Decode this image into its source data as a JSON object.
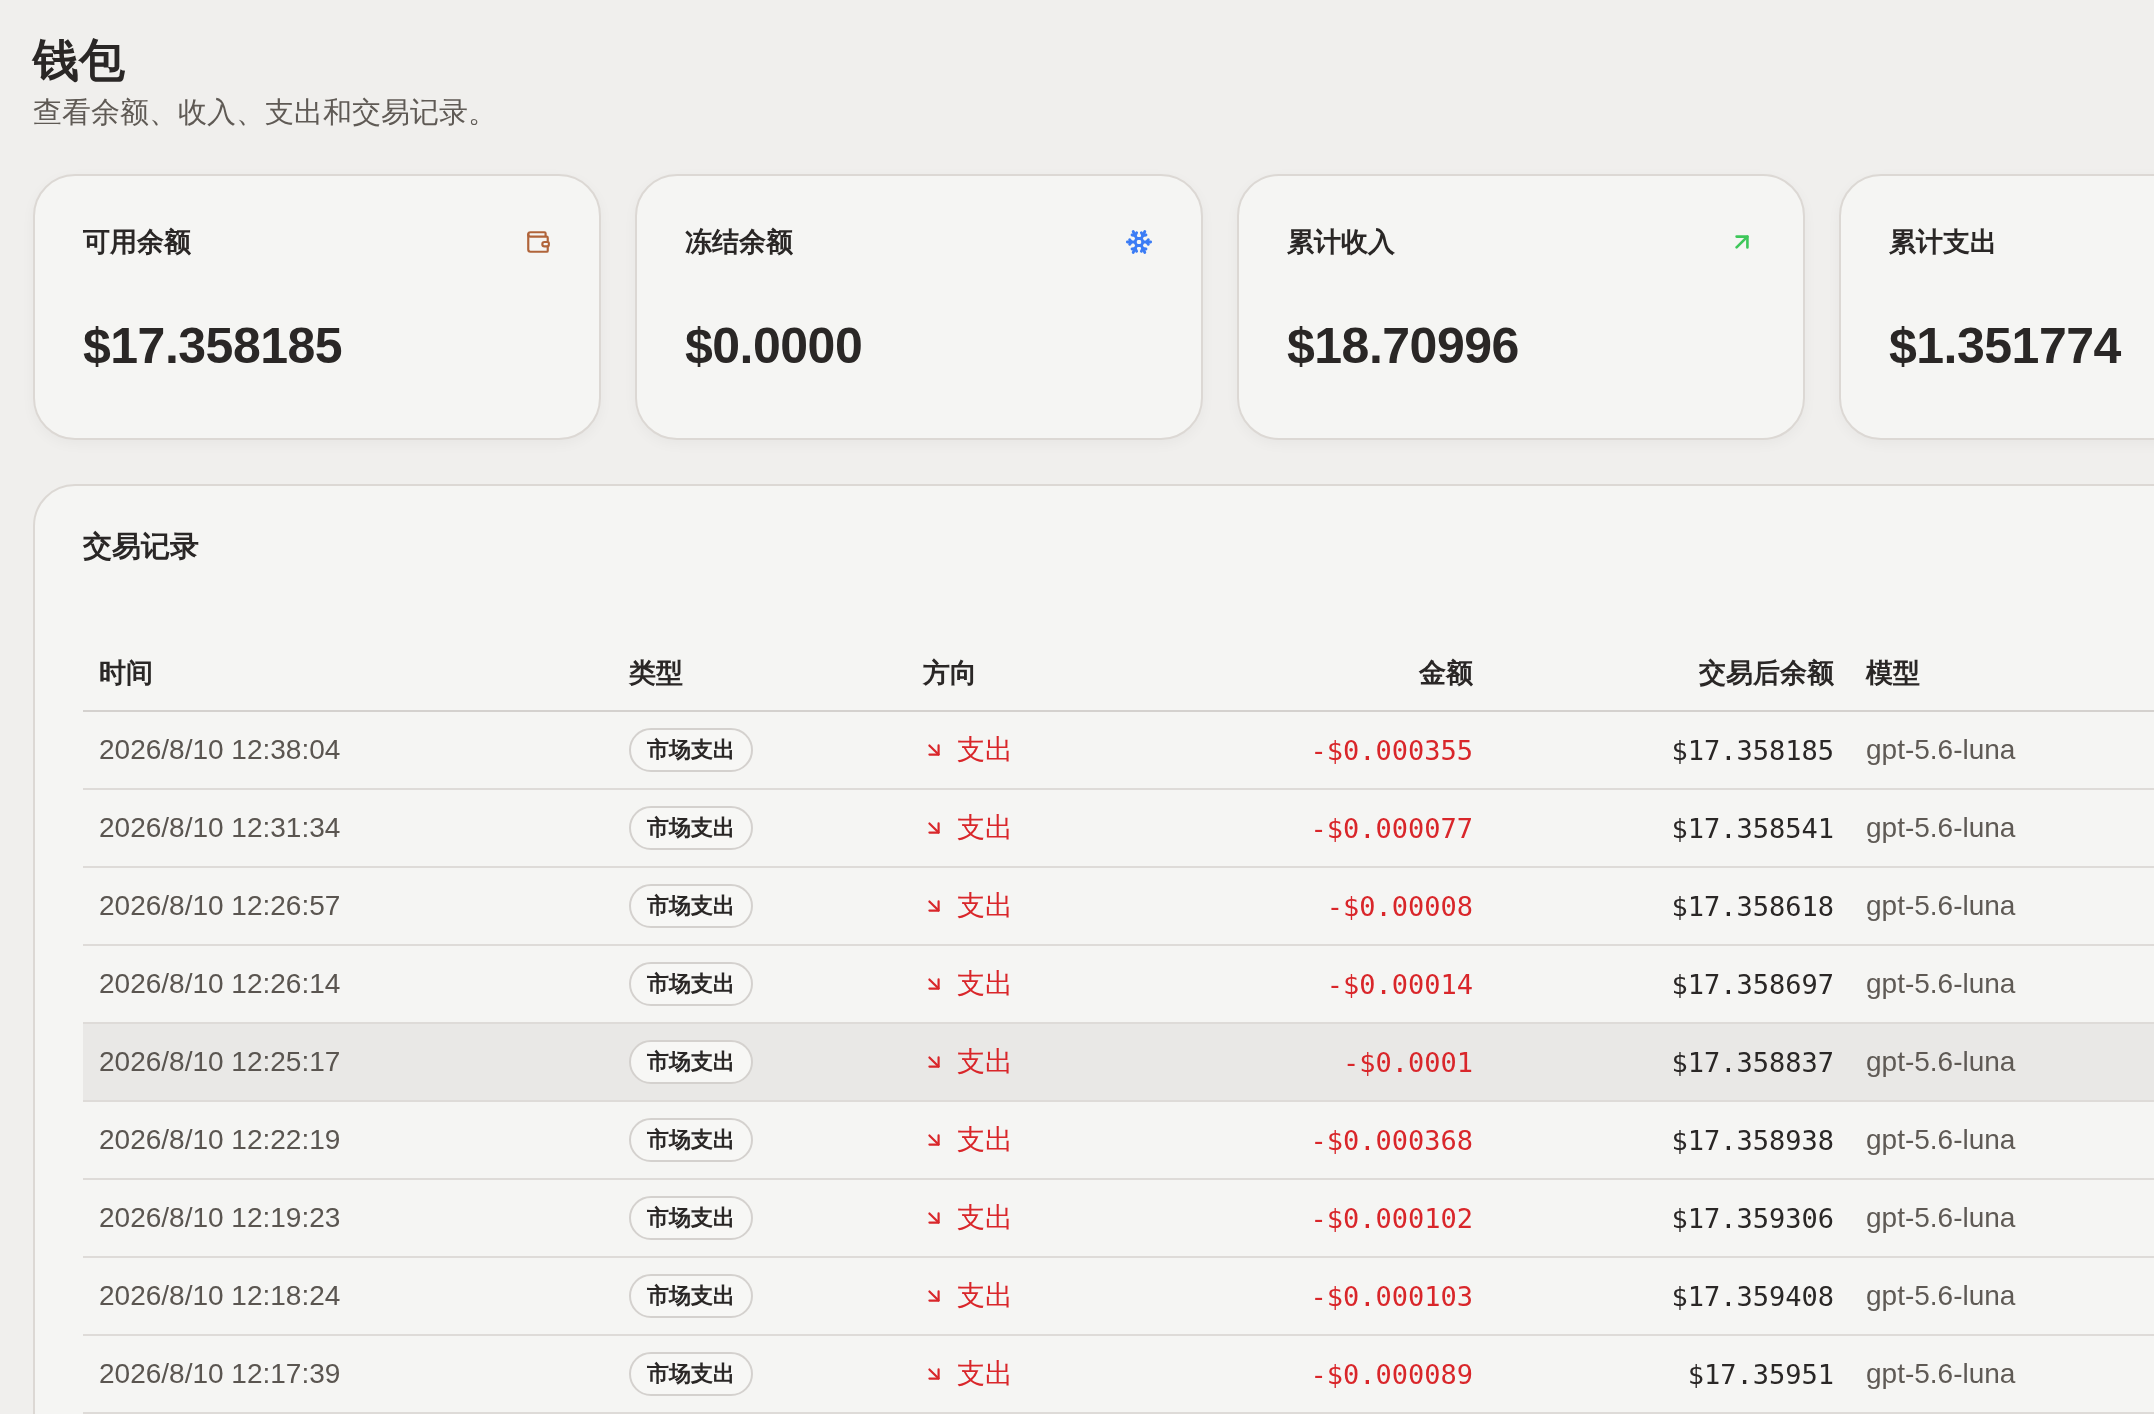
{
  "page": {
    "title": "钱包",
    "subtitle": "查看余额、收入、支出和交易记录。"
  },
  "cards": [
    {
      "kind": "available",
      "label": "可用余额",
      "value": "$17.358185"
    },
    {
      "kind": "frozen",
      "label": "冻结余额",
      "value": "$0.0000"
    },
    {
      "kind": "income",
      "label": "累计收入",
      "value": "$18.70996"
    },
    {
      "kind": "expense",
      "label": "累计支出",
      "value": "$1.351774"
    }
  ],
  "transactions": {
    "title": "交易记录",
    "columns": [
      "时间",
      "类型",
      "方向",
      "金额",
      "交易后余额",
      "模型"
    ],
    "rows": [
      {
        "time": "2026/8/10 12:38:04",
        "type": "市场支出",
        "direction": {
          "kind": "out",
          "label": "支出"
        },
        "amount": "-$0.000355",
        "balance": "$17.358185",
        "model": "gpt-5.6-luna",
        "highlighted": false
      },
      {
        "time": "2026/8/10 12:31:34",
        "type": "市场支出",
        "direction": {
          "kind": "out",
          "label": "支出"
        },
        "amount": "-$0.000077",
        "balance": "$17.358541",
        "model": "gpt-5.6-luna",
        "highlighted": false
      },
      {
        "time": "2026/8/10 12:26:57",
        "type": "市场支出",
        "direction": {
          "kind": "out",
          "label": "支出"
        },
        "amount": "-$0.00008",
        "balance": "$17.358618",
        "model": "gpt-5.6-luna",
        "highlighted": false
      },
      {
        "time": "2026/8/10 12:26:14",
        "type": "市场支出",
        "direction": {
          "kind": "out",
          "label": "支出"
        },
        "amount": "-$0.00014",
        "balance": "$17.358697",
        "model": "gpt-5.6-luna",
        "highlighted": false
      },
      {
        "time": "2026/8/10 12:25:17",
        "type": "市场支出",
        "direction": {
          "kind": "out",
          "label": "支出"
        },
        "amount": "-$0.0001",
        "balance": "$17.358837",
        "model": "gpt-5.6-luna",
        "highlighted": true
      },
      {
        "time": "2026/8/10 12:22:19",
        "type": "市场支出",
        "direction": {
          "kind": "out",
          "label": "支出"
        },
        "amount": "-$0.000368",
        "balance": "$17.358938",
        "model": "gpt-5.6-luna",
        "highlighted": false
      },
      {
        "time": "2026/8/10 12:19:23",
        "type": "市场支出",
        "direction": {
          "kind": "out",
          "label": "支出"
        },
        "amount": "-$0.000102",
        "balance": "$17.359306",
        "model": "gpt-5.6-luna",
        "highlighted": false
      },
      {
        "time": "2026/8/10 12:18:24",
        "type": "市场支出",
        "direction": {
          "kind": "out",
          "label": "支出"
        },
        "amount": "-$0.000103",
        "balance": "$17.359408",
        "model": "gpt-5.6-luna",
        "highlighted": false
      },
      {
        "time": "2026/8/10 12:17:39",
        "type": "市场支出",
        "direction": {
          "kind": "out",
          "label": "支出"
        },
        "amount": "-$0.000089",
        "balance": "$17.35951",
        "model": "gpt-5.6-luna",
        "highlighted": false
      }
    ]
  }
}
